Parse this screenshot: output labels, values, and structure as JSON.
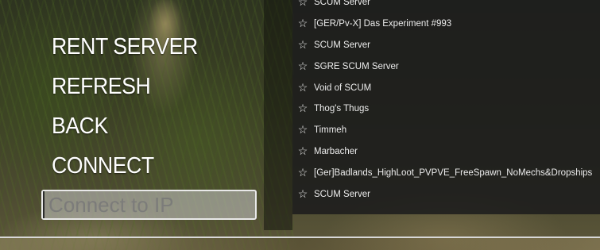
{
  "menu": {
    "rent_server": "RENT SERVER",
    "refresh": "REFRESH",
    "back": "BACK",
    "connect": "CONNECT"
  },
  "connect_ip": {
    "placeholder": "Connect to IP",
    "value": ""
  },
  "servers": [
    {
      "name": "SCUM Server",
      "favorite": false
    },
    {
      "name": "[GER/Pv-X] Das Experiment #993",
      "favorite": false
    },
    {
      "name": "SCUM Server",
      "favorite": false
    },
    {
      "name": "SGRE SCUM Server",
      "favorite": false
    },
    {
      "name": "Void of SCUM",
      "favorite": false
    },
    {
      "name": "Thog's Thugs",
      "favorite": false
    },
    {
      "name": "Timmeh",
      "favorite": false
    },
    {
      "name": "Marbacher",
      "favorite": false
    },
    {
      "name": "[Ger]Badlands_HighLoot_PVPVE_FreeSpawn_NoMechs&Dropships",
      "favorite": false
    },
    {
      "name": "SCUM Server",
      "favorite": false
    }
  ],
  "icons": {
    "favorite": "star-outline-icon"
  },
  "colors": {
    "panel_bg": "#1c1c1c",
    "text": "#ffffff",
    "input_border": "#e9e9e9"
  }
}
